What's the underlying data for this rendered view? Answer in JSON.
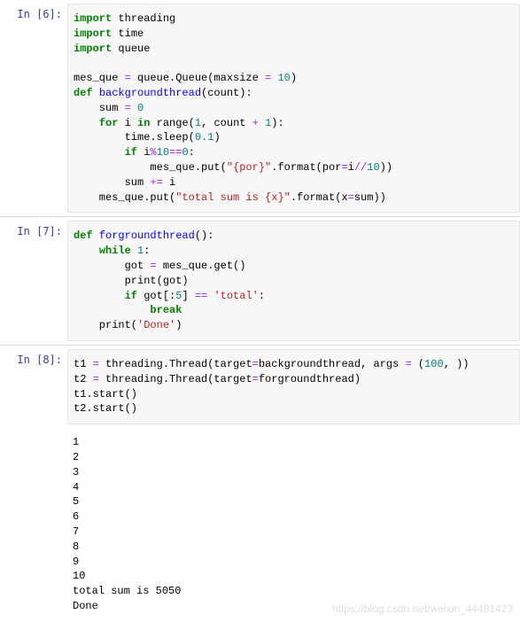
{
  "cells": [
    {
      "prompt": "In  [6]:",
      "code_tokens": [
        {
          "t": "import",
          "c": "kw"
        },
        {
          "t": " threading\n"
        },
        {
          "t": "import",
          "c": "kw"
        },
        {
          "t": " time\n"
        },
        {
          "t": "import",
          "c": "kw"
        },
        {
          "t": " queue\n\n"
        },
        {
          "t": "mes_que "
        },
        {
          "t": "=",
          "c": "op"
        },
        {
          "t": " queue.Queue(maxsize "
        },
        {
          "t": "=",
          "c": "op"
        },
        {
          "t": " "
        },
        {
          "t": "10",
          "c": "num"
        },
        {
          "t": ")\n"
        },
        {
          "t": "def",
          "c": "kw"
        },
        {
          "t": " "
        },
        {
          "t": "backgroundthread",
          "c": "fn"
        },
        {
          "t": "(count):\n"
        },
        {
          "t": "    sum "
        },
        {
          "t": "=",
          "c": "op"
        },
        {
          "t": " "
        },
        {
          "t": "0",
          "c": "num"
        },
        {
          "t": "\n"
        },
        {
          "t": "    "
        },
        {
          "t": "for",
          "c": "kw"
        },
        {
          "t": " i "
        },
        {
          "t": "in",
          "c": "kw"
        },
        {
          "t": " range("
        },
        {
          "t": "1",
          "c": "num"
        },
        {
          "t": ", count "
        },
        {
          "t": "+",
          "c": "op"
        },
        {
          "t": " "
        },
        {
          "t": "1",
          "c": "num"
        },
        {
          "t": "):\n"
        },
        {
          "t": "        time.sleep("
        },
        {
          "t": "0.1",
          "c": "num"
        },
        {
          "t": ")\n"
        },
        {
          "t": "        "
        },
        {
          "t": "if",
          "c": "kw"
        },
        {
          "t": " i"
        },
        {
          "t": "%",
          "c": "op"
        },
        {
          "t": "10",
          "c": "num"
        },
        {
          "t": "==",
          "c": "op"
        },
        {
          "t": "0",
          "c": "num"
        },
        {
          "t": ":\n"
        },
        {
          "t": "            mes_que.put("
        },
        {
          "t": "\"{por}\"",
          "c": "str"
        },
        {
          "t": ".format(por"
        },
        {
          "t": "=",
          "c": "op"
        },
        {
          "t": "i"
        },
        {
          "t": "//",
          "c": "op"
        },
        {
          "t": "10",
          "c": "num"
        },
        {
          "t": "))\n"
        },
        {
          "t": "        sum "
        },
        {
          "t": "+=",
          "c": "op"
        },
        {
          "t": " i\n"
        },
        {
          "t": "    mes_que.put("
        },
        {
          "t": "\"total sum is {x}\"",
          "c": "str"
        },
        {
          "t": ".format(x"
        },
        {
          "t": "=",
          "c": "op"
        },
        {
          "t": "sum))"
        }
      ]
    },
    {
      "prompt": "In  [7]:",
      "code_tokens": [
        {
          "t": "def",
          "c": "kw"
        },
        {
          "t": " "
        },
        {
          "t": "forgroundthread",
          "c": "fn"
        },
        {
          "t": "():\n"
        },
        {
          "t": "    "
        },
        {
          "t": "while",
          "c": "kw"
        },
        {
          "t": " "
        },
        {
          "t": "1",
          "c": "num"
        },
        {
          "t": ":\n"
        },
        {
          "t": "        got "
        },
        {
          "t": "=",
          "c": "op"
        },
        {
          "t": " mes_que.get()\n"
        },
        {
          "t": "        print(got)\n"
        },
        {
          "t": "        "
        },
        {
          "t": "if",
          "c": "kw"
        },
        {
          "t": " got[:"
        },
        {
          "t": "5",
          "c": "num"
        },
        {
          "t": "] "
        },
        {
          "t": "==",
          "c": "op"
        },
        {
          "t": " "
        },
        {
          "t": "'total'",
          "c": "str"
        },
        {
          "t": ":\n"
        },
        {
          "t": "            "
        },
        {
          "t": "break",
          "c": "kw"
        },
        {
          "t": "\n"
        },
        {
          "t": "    print("
        },
        {
          "t": "'Done'",
          "c": "str"
        },
        {
          "t": ")"
        }
      ]
    },
    {
      "prompt": "In  [8]:",
      "code_tokens": [
        {
          "t": "t1 "
        },
        {
          "t": "=",
          "c": "op"
        },
        {
          "t": " threading.Thread(target"
        },
        {
          "t": "=",
          "c": "op"
        },
        {
          "t": "backgroundthread, args "
        },
        {
          "t": "=",
          "c": "op"
        },
        {
          "t": " ("
        },
        {
          "t": "100",
          "c": "num"
        },
        {
          "t": ", ))\n"
        },
        {
          "t": "t2 "
        },
        {
          "t": "=",
          "c": "op"
        },
        {
          "t": " threading.Thread(target"
        },
        {
          "t": "=",
          "c": "op"
        },
        {
          "t": "forgroundthread)\n"
        },
        {
          "t": "t1.start()\n"
        },
        {
          "t": "t2.start()"
        }
      ],
      "output": "1\n2\n3\n4\n5\n6\n7\n8\n9\n10\ntotal sum is 5050\nDone"
    }
  ],
  "watermark": "https://blog.csdn.net/weixin_44491423"
}
